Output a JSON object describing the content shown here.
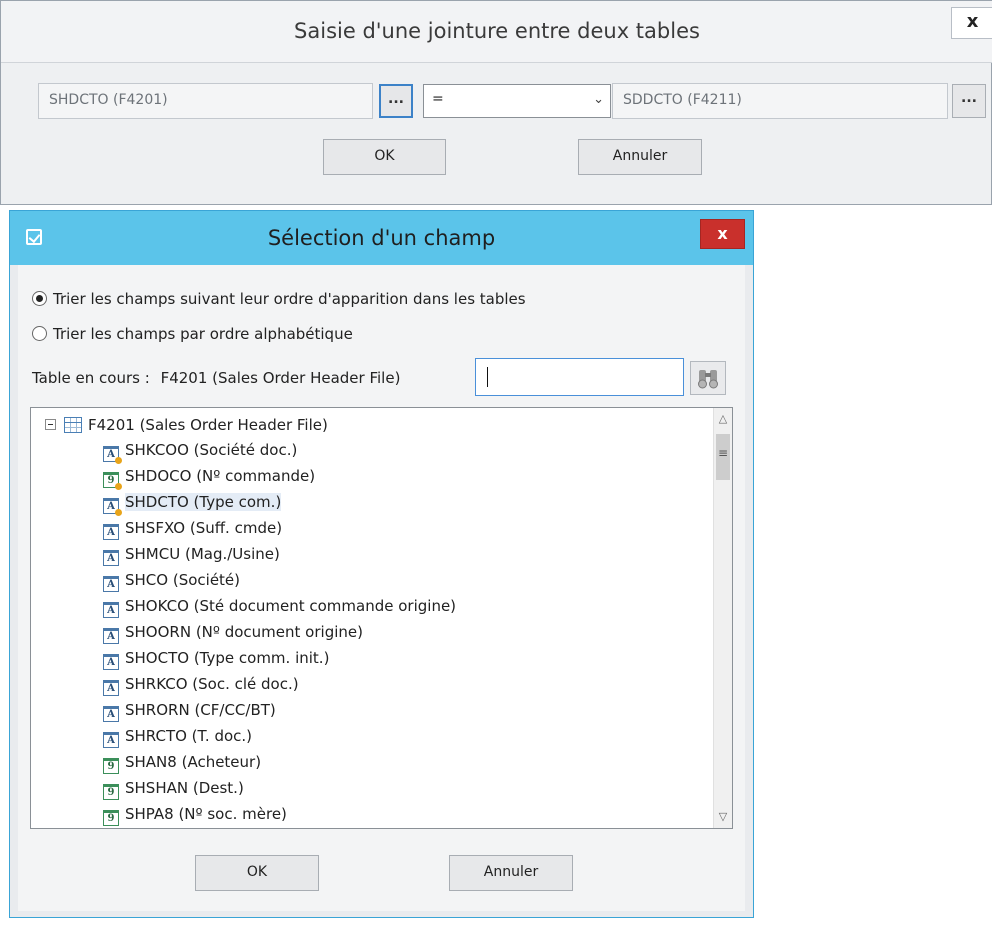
{
  "join_dialog": {
    "title": "Saisie d'une jointure entre deux tables",
    "close_label": "x",
    "left_field": "SHDCTO (F4201)",
    "browse_label": "...",
    "operator": "=",
    "right_field": "SDDCTO (F4211)",
    "ok_label": "OK",
    "cancel_label": "Annuler"
  },
  "field_dialog": {
    "title": "Sélection d'un champ",
    "close_label": "x",
    "sort_options": [
      {
        "label": "Trier les champs suivant leur ordre d'apparition dans les tables",
        "selected": true
      },
      {
        "label": "Trier les champs par ordre alphabétique",
        "selected": false
      }
    ],
    "current_table_label": "Table en cours :",
    "current_table_value": "F4201 (Sales Order Header File)",
    "search_value": "",
    "tree": {
      "root_label": "F4201 (Sales Order Header File)",
      "items": [
        {
          "label": "SHKCOO (Société doc.)",
          "icon": "alpha-key",
          "glyph": "A"
        },
        {
          "label": "SHDOCO (Nº commande)",
          "icon": "numeric-key",
          "glyph": "9"
        },
        {
          "label": "SHDCTO (Type com.)",
          "icon": "alpha-key",
          "glyph": "A",
          "selected": true
        },
        {
          "label": "SHSFXO (Suff. cmde)",
          "icon": "alpha",
          "glyph": "A"
        },
        {
          "label": "SHMCU (Mag./Usine)",
          "icon": "alpha",
          "glyph": "A"
        },
        {
          "label": "SHCO (Société)",
          "icon": "alpha",
          "glyph": "A"
        },
        {
          "label": "SHOKCO (Sté document commande origine)",
          "icon": "alpha",
          "glyph": "A"
        },
        {
          "label": "SHOORN (Nº document origine)",
          "icon": "alpha",
          "glyph": "A"
        },
        {
          "label": "SHOCTO (Type comm. init.)",
          "icon": "alpha",
          "glyph": "A"
        },
        {
          "label": "SHRKCO (Soc. clé doc.)",
          "icon": "alpha",
          "glyph": "A"
        },
        {
          "label": "SHRORN (CF/CC/BT)",
          "icon": "alpha",
          "glyph": "A"
        },
        {
          "label": "SHRCTO (T. doc.)",
          "icon": "alpha",
          "glyph": "A"
        },
        {
          "label": "SHAN8 (Acheteur)",
          "icon": "numeric",
          "glyph": "9"
        },
        {
          "label": "SHSHAN (Dest.)",
          "icon": "numeric",
          "glyph": "9"
        },
        {
          "label": "SHPA8 (Nº soc. mère)",
          "icon": "numeric",
          "glyph": "9"
        }
      ]
    },
    "ok_label": "OK",
    "cancel_label": "Annuler"
  }
}
